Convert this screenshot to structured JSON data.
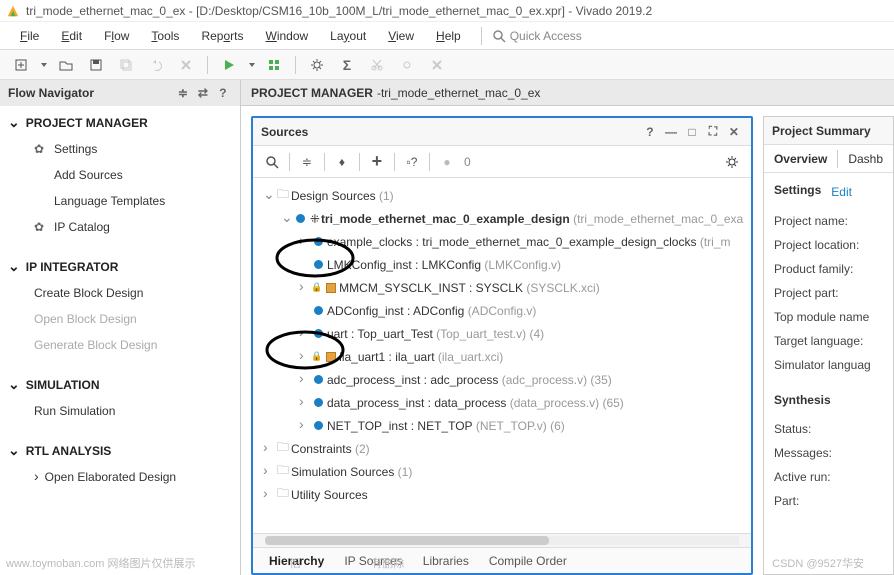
{
  "window": {
    "title": "tri_mode_ethernet_mac_0_ex - [D:/Desktop/CSM16_10b_100M_L/tri_mode_ethernet_mac_0_ex.xpr] - Vivado 2019.2"
  },
  "menu": {
    "file": "File",
    "edit": "Edit",
    "flow": "Flow",
    "tools": "Tools",
    "reports": "Reports",
    "window": "Window",
    "layout": "Layout",
    "view": "View",
    "help": "Help",
    "quick_access": "Quick Access"
  },
  "flow_nav": {
    "title": "Flow Navigator",
    "sections": {
      "pm": {
        "title": "PROJECT MANAGER",
        "items": {
          "settings": "Settings",
          "add_sources": "Add Sources",
          "lang_templates": "Language Templates",
          "ip_catalog": "IP Catalog"
        }
      },
      "ipi": {
        "title": "IP INTEGRATOR",
        "items": {
          "create_bd": "Create Block Design",
          "open_bd": "Open Block Design",
          "gen_bd": "Generate Block Design"
        }
      },
      "sim": {
        "title": "SIMULATION",
        "items": {
          "run_sim": "Run Simulation"
        }
      },
      "rtl": {
        "title": "RTL ANALYSIS",
        "items": {
          "open_elab": "Open Elaborated Design"
        }
      }
    }
  },
  "pm_header": {
    "title": "PROJECT MANAGER",
    "subtitle": "tri_mode_ethernet_mac_0_ex"
  },
  "sources": {
    "title": "Sources",
    "count_badge": "0",
    "tree": {
      "design_sources": {
        "label": "Design Sources",
        "count": "(1)"
      },
      "top": {
        "label": "tri_mode_ethernet_mac_0_example_design",
        "hint": "(tri_mode_ethernet_mac_0_exa"
      },
      "example_clocks": {
        "label": "example_clocks : tri_mode_ethernet_mac_0_example_design_clocks",
        "hint": "(tri_m"
      },
      "lmk": {
        "label": "LMKConfig_inst : LMKConfig",
        "hint": "(LMKConfig.v)"
      },
      "mmcm": {
        "label": "MMCM_SYSCLK_INST : SYSCLK",
        "hint": "(SYSCLK.xci)"
      },
      "adconfig": {
        "label": "ADConfig_inst : ADConfig",
        "hint": "(ADConfig.v)"
      },
      "uart": {
        "label": "uart : Top_uart_Test",
        "hint": "(Top_uart_test.v) (4)"
      },
      "ila": {
        "label": "ila_uart1 : ila_uart",
        "hint": "(ila_uart.xci)"
      },
      "adc_proc": {
        "label": "adc_process_inst : adc_process",
        "hint": "(adc_process.v) (35)"
      },
      "data_proc": {
        "label": "data_process_inst : data_process",
        "hint": "(data_process.v) (65)"
      },
      "net_top": {
        "label": "NET_TOP_inst : NET_TOP",
        "hint": "(NET_TOP.v) (6)"
      },
      "constraints": {
        "label": "Constraints",
        "count": "(2)"
      },
      "sim_sources": {
        "label": "Simulation Sources",
        "count": "(1)"
      },
      "utility": {
        "label": "Utility Sources"
      }
    },
    "tabs": {
      "hierarchy": "Hierarchy",
      "ip_sources": "IP Sources",
      "libraries": "Libraries",
      "compile_order": "Compile Order"
    }
  },
  "summary": {
    "title": "Project Summary",
    "tabs": {
      "overview": "Overview",
      "dashboard": "Dashb"
    },
    "settings": {
      "title": "Settings",
      "edit": "Edit",
      "rows": {
        "pname": "Project name:",
        "ploc": "Project location:",
        "pfam": "Product family:",
        "ppart": "Project part:",
        "topmod": "Top module name",
        "tlang": "Target language:",
        "simlang": "Simulator languag"
      }
    },
    "synthesis": {
      "title": "Synthesis",
      "rows": {
        "status": "Status:",
        "msgs": "Messages:",
        "active": "Active run:",
        "part": "Part:"
      }
    }
  },
  "watermarks": {
    "left": "www.toymoban.com 网络图片仅供展示",
    "mid_prefix": "旧",
    "mid_suffix": "有删除",
    "right": "CSDN @9527华安"
  }
}
